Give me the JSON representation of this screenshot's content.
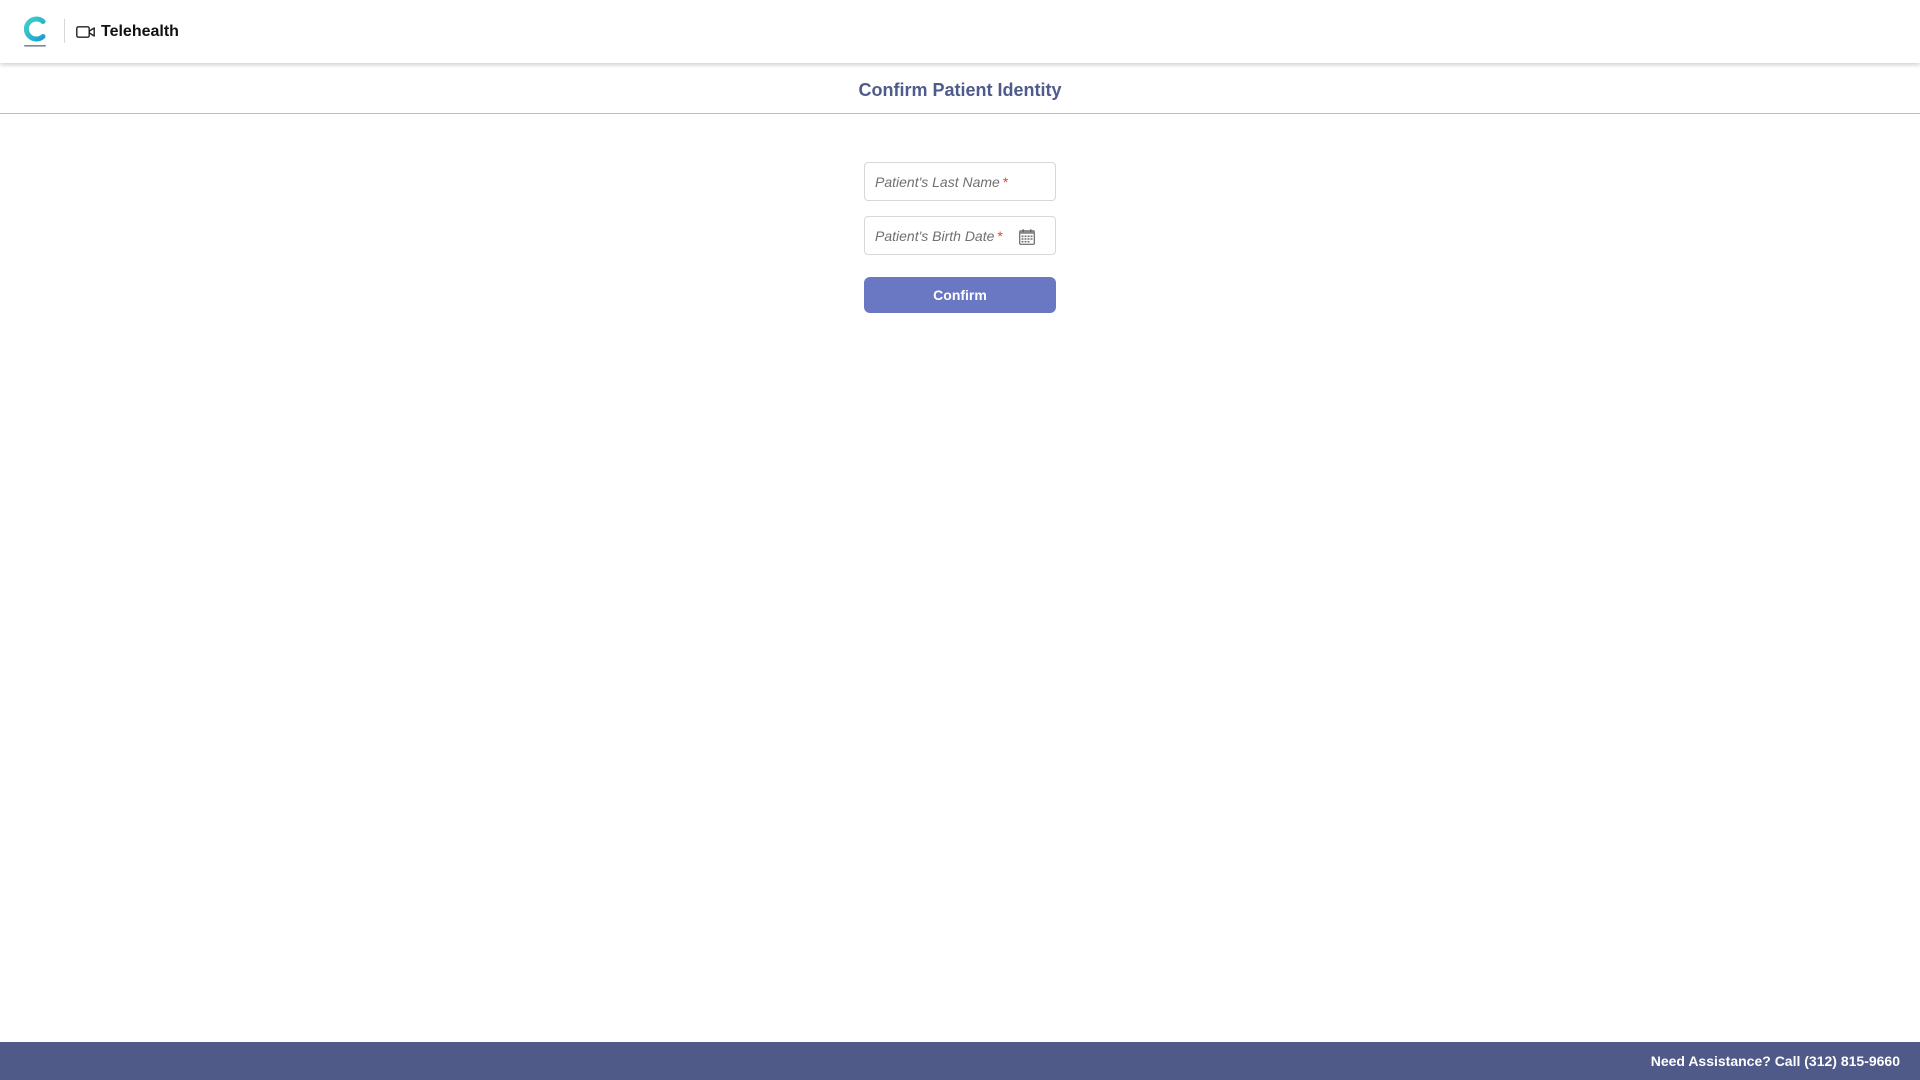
{
  "header": {
    "logo_icon": "clinic-logo-icon",
    "app_icon": "video-camera-icon",
    "app_title": "Telehealth"
  },
  "page": {
    "title": "Confirm Patient Identity"
  },
  "form": {
    "last_name": {
      "placeholder": "Patient's Last Name",
      "required_mark": "*",
      "value": ""
    },
    "birth_date": {
      "placeholder": "Patient's Birth Date",
      "required_mark": "*",
      "value": "",
      "icon": "calendar-icon"
    },
    "confirm_label": "Confirm"
  },
  "footer": {
    "assistance_text": "Need Assistance? Call (312) 815-9660"
  },
  "colors": {
    "accent": "#6a77c3",
    "title": "#4f5b8a",
    "footer_bg": "#4f5a89",
    "required": "#e2452b",
    "logo_teal": "#2bc0c8"
  }
}
